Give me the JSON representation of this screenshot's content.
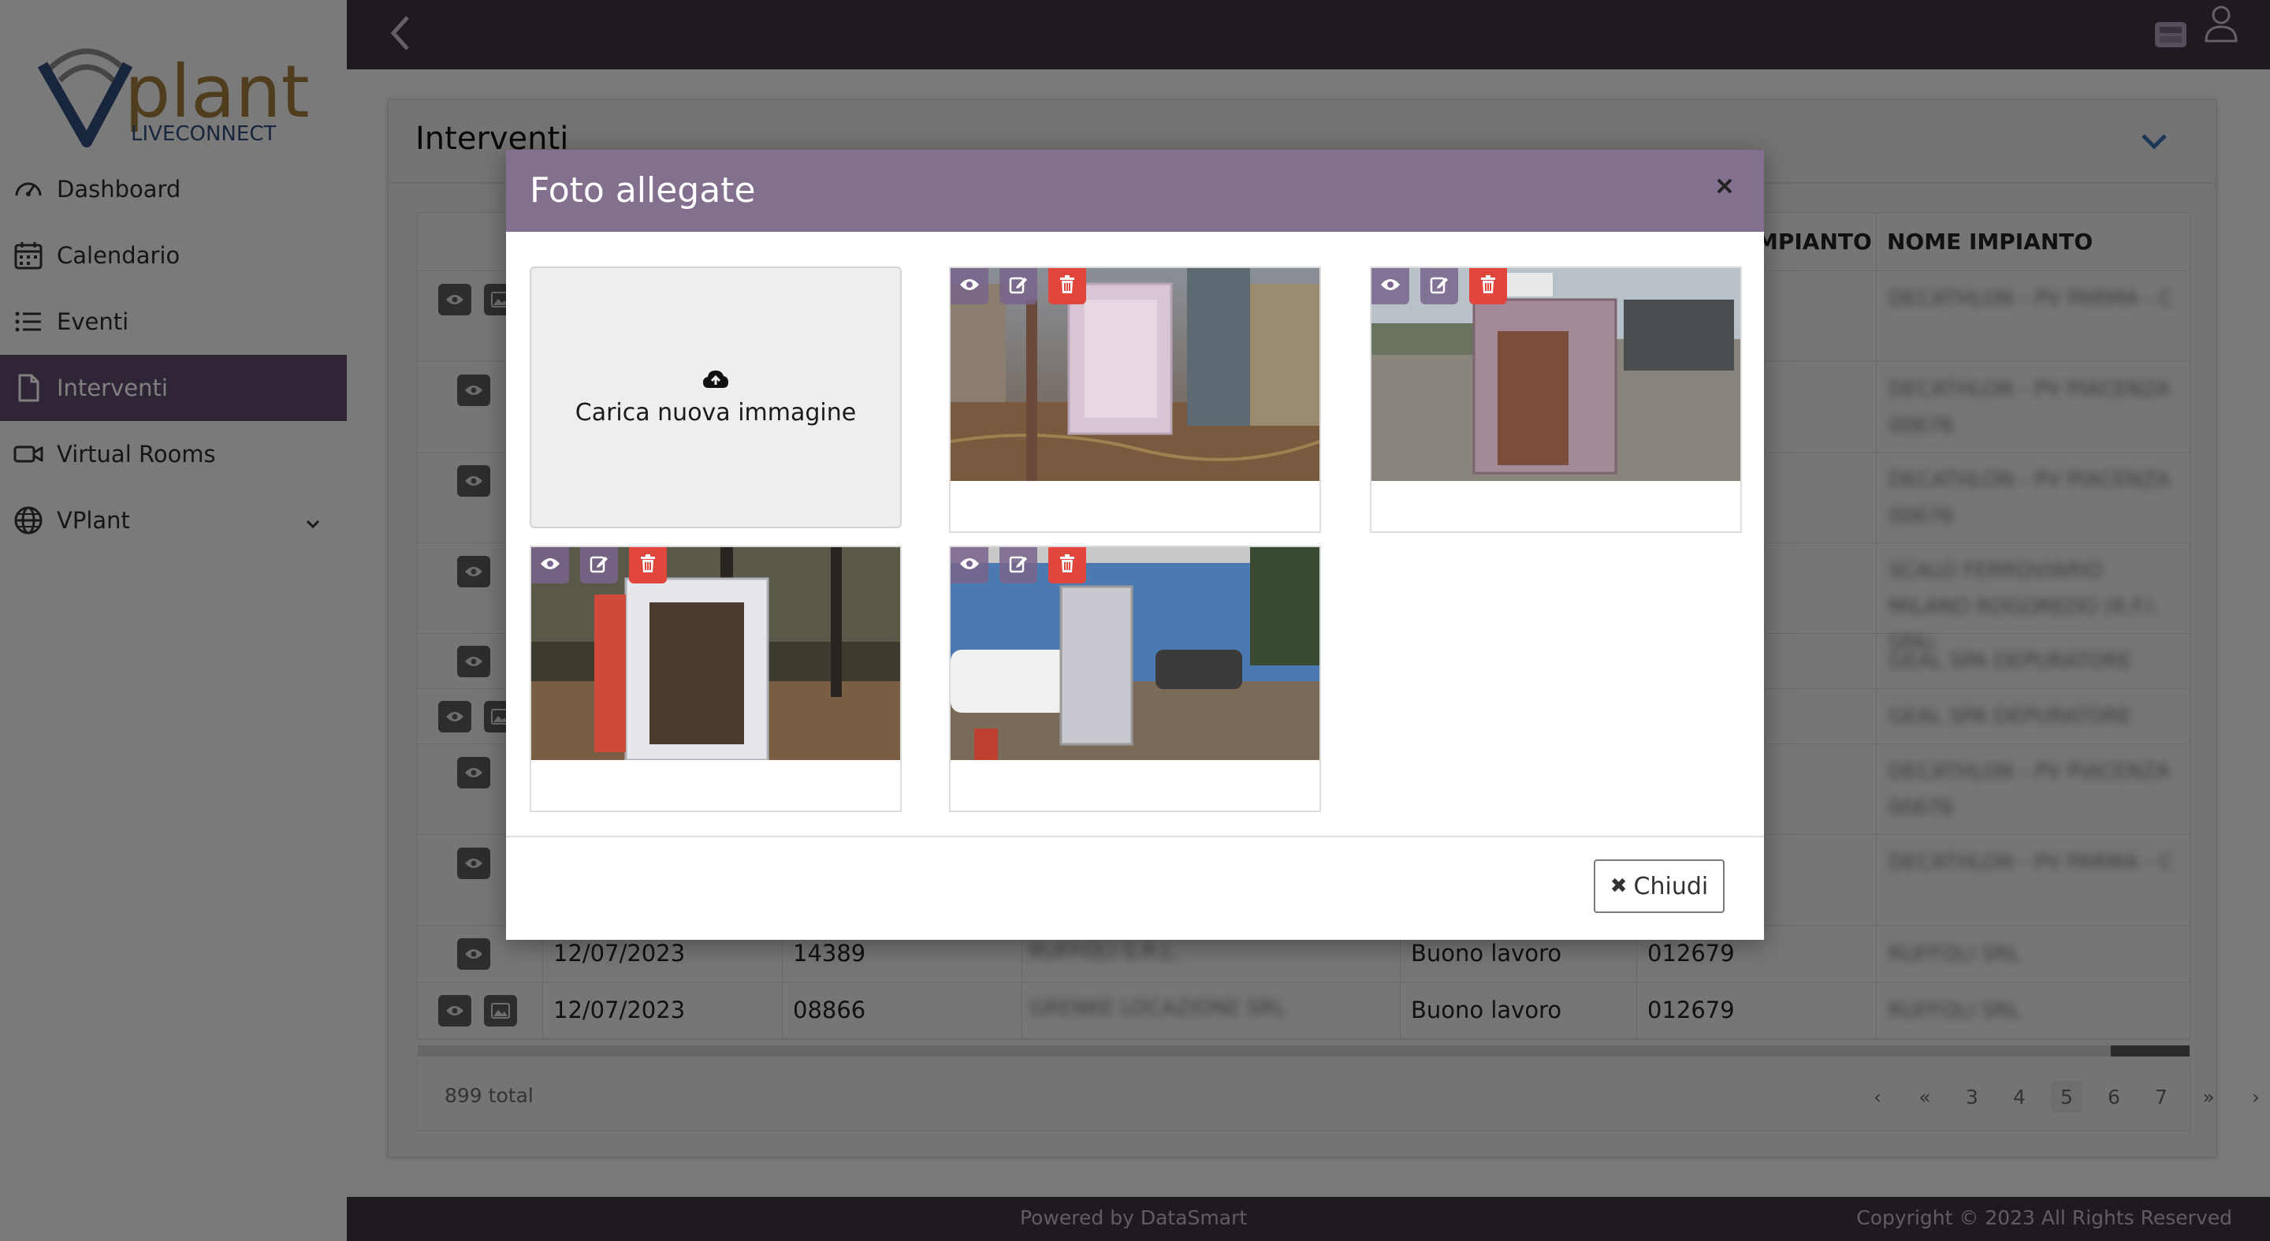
{
  "brand": {
    "logo_main": "Vplant",
    "logo_sub": "LIVECONNECT"
  },
  "sidebar": {
    "items": [
      {
        "label": "Dashboard",
        "icon": "gauge-icon"
      },
      {
        "label": "Calendario",
        "icon": "calendar-icon"
      },
      {
        "label": "Eventi",
        "icon": "list-icon"
      },
      {
        "label": "Interventi",
        "icon": "document-icon",
        "active": true
      },
      {
        "label": "Virtual Rooms",
        "icon": "video-camera-icon"
      },
      {
        "label": "VPlant",
        "icon": "globe-icon",
        "has_submenu": true
      }
    ]
  },
  "header": {
    "back_icon": "chevron-left-icon",
    "inbox_icon": "inbox-icon",
    "user_icon": "user-icon"
  },
  "card": {
    "title": "Interventi",
    "table": {
      "columns": [
        "MPIANTO",
        "NOME IMPIANTO"
      ],
      "rows": [
        {
          "date": "",
          "num": "",
          "type": "",
          "code": "",
          "name_blurred": "DECATHLON - PV PARMA - C",
          "actions": [
            "view",
            "image"
          ]
        },
        {
          "date": "",
          "num": "",
          "type": "",
          "code": "",
          "name_blurred": "DECATHLON - PV PIACENZA 00676",
          "actions": [
            "view"
          ]
        },
        {
          "date": "",
          "num": "",
          "type": "",
          "code": "",
          "name_blurred": "DECATHLON - PV PIACENZA 00676",
          "actions": [
            "view"
          ]
        },
        {
          "date": "",
          "num": "",
          "type": "",
          "code": "",
          "name_blurred": "SCALO FERROVIARIO MILANO ROGOREDO (R.F.I. SPA)",
          "actions": [
            "view"
          ]
        },
        {
          "date": "",
          "num": "",
          "type": "",
          "code": "",
          "name_blurred": "GEAL SPA DEPURATORE",
          "actions": [
            "view"
          ]
        },
        {
          "date": "",
          "num": "",
          "type": "",
          "code": "",
          "name_blurred": "GEAL SPA DEPURATORE",
          "actions": [
            "view",
            "image"
          ]
        },
        {
          "date": "",
          "num": "",
          "type": "",
          "code": "",
          "name_blurred": "DECATHLON - PV PIACENZA 00676",
          "actions": [
            "view"
          ]
        },
        {
          "date": "",
          "num": "",
          "type": "",
          "code": "",
          "name_blurred": "DECATHLON - PV PARMA - C",
          "actions": [
            "view"
          ]
        },
        {
          "date": "12/07/2023",
          "num": "14389",
          "client_blurred": "RUFFOLI S.R.L.",
          "type": "Buono lavoro",
          "code": "012679",
          "name_blurred": "RUFFOLI SRL",
          "actions": [
            "view"
          ]
        },
        {
          "date": "12/07/2023",
          "num": "08866",
          "client_blurred": "GRENKE LOCAZIONE SRL",
          "type": "Buono lavoro",
          "code": "012679",
          "name_blurred": "RUFFOLI SRL",
          "actions": [
            "view",
            "image"
          ]
        }
      ]
    },
    "pagination": {
      "total": "899 total",
      "prev": "‹",
      "first": "«",
      "pages": [
        "3",
        "4",
        "5",
        "6",
        "7"
      ],
      "current": "5",
      "last": "»",
      "next": "›"
    }
  },
  "footer": {
    "powered": "Powered by DataSmart",
    "copyright": "Copyright © 2023 All Rights Reserved"
  },
  "modal": {
    "title": "Foto allegate",
    "upload_label": "Carica nuova immagine",
    "close_label": "Chiudi",
    "photos": [
      {
        "scene": "pink fire cabinet near pipes",
        "tools": [
          "view",
          "edit",
          "delete"
        ]
      },
      {
        "scene": "rusty cabinet on gravel",
        "tools": [
          "view",
          "edit",
          "delete"
        ]
      },
      {
        "scene": "white cabinet in park",
        "tools": [
          "view",
          "edit",
          "delete"
        ]
      },
      {
        "scene": "cabinet by blue building",
        "tools": [
          "view",
          "edit",
          "delete"
        ]
      }
    ]
  },
  "colors": {
    "sidebar_active": "#5e4a6e",
    "topbar": "#3f3245",
    "modal_header": "#83708f",
    "delete": "#e0463c",
    "logo_blue": "#2f4a7a",
    "logo_gold": "#a07a3c"
  }
}
